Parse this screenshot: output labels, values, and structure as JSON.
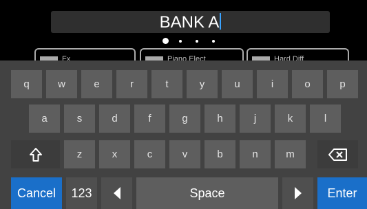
{
  "name_field": {
    "value": "BANK A"
  },
  "pager": {
    "page_count": 4,
    "active_index": 0
  },
  "peek_cards": [
    {
      "label": "Fx"
    },
    {
      "label": "Piano Elect"
    },
    {
      "label": "Hard Diff"
    }
  ],
  "keyboard": {
    "row1": [
      "q",
      "w",
      "e",
      "r",
      "t",
      "y",
      "u",
      "i",
      "o",
      "p"
    ],
    "row2": [
      "a",
      "s",
      "d",
      "f",
      "g",
      "h",
      "j",
      "k",
      "l"
    ],
    "row3": [
      "z",
      "x",
      "c",
      "v",
      "b",
      "n",
      "m"
    ],
    "shift_icon": "shift-arrow-icon",
    "backspace_icon": "backspace-icon",
    "cancel_label": "Cancel",
    "numbers_label": "123",
    "cursor_left_icon": "triangle-left-icon",
    "space_label": "Space",
    "cursor_right_icon": "triangle-right-icon",
    "enter_label": "Enter"
  },
  "colors": {
    "accent": "#1a6fc9",
    "caret": "#3aa3ff",
    "key": "#5e5e5e",
    "keyboard_bg": "#424242"
  }
}
